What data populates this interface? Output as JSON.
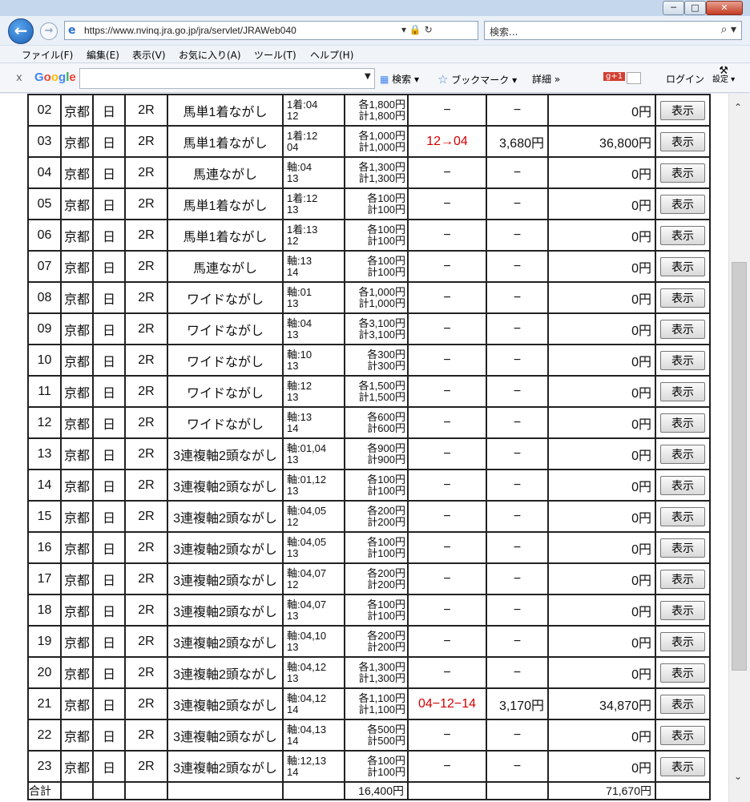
{
  "window": {
    "minimize": "─",
    "maximize": "□",
    "close": "✕"
  },
  "nav": {
    "back_icon": "back-arrow-icon",
    "forward_icon": "forward-arrow-icon",
    "url": "https://www.nvinq.jra.go.jp/jra/servlet/JRAWeb040",
    "url_tools": "▾ 🔒 ↻",
    "search_placeholder": "検索...",
    "search_glyph": "⌕ ▾"
  },
  "menu": [
    "ファイル(F)",
    "編集(E)",
    "表示(V)",
    "お気に入り(A)",
    "ツール(T)",
    "ヘルプ(H)"
  ],
  "googlebar": {
    "close": "x",
    "logo": [
      "G",
      "o",
      "o",
      "g",
      "l",
      "e"
    ],
    "logo_colors": [
      "#4285f4",
      "#ea4335",
      "#fbbc05",
      "#4285f4",
      "#34a853",
      "#ea4335"
    ],
    "search": "検索 ▾",
    "bookmark": "ブックマーク ▾",
    "detail": "詳細 »",
    "gplus": "g+1",
    "login": "ログイン",
    "settings": "設定 ▾"
  },
  "show_label": "表示",
  "rows": [
    {
      "no": "02",
      "place": "京都",
      "day": "日",
      "race": "2R",
      "type": "馬単1着ながし",
      "bet1": "1着:04",
      "bet2": "12",
      "amt1": "各1,800円",
      "amt2": "計1,800円",
      "hit": "−",
      "pay": "−",
      "ret": "0円"
    },
    {
      "no": "03",
      "place": "京都",
      "day": "日",
      "race": "2R",
      "type": "馬単1着ながし",
      "bet1": "1着:12",
      "bet2": "04",
      "amt1": "各1,000円",
      "amt2": "計1,000円",
      "hit": "12→04",
      "pay": "3,680円",
      "ret": "36,800円",
      "is_hit": true
    },
    {
      "no": "04",
      "place": "京都",
      "day": "日",
      "race": "2R",
      "type": "馬連ながし",
      "bet1": "軸:04",
      "bet2": "13",
      "amt1": "各1,300円",
      "amt2": "計1,300円",
      "hit": "−",
      "pay": "−",
      "ret": "0円"
    },
    {
      "no": "05",
      "place": "京都",
      "day": "日",
      "race": "2R",
      "type": "馬単1着ながし",
      "bet1": "1着:12",
      "bet2": "13",
      "amt1": "各100円",
      "amt2": "計100円",
      "hit": "−",
      "pay": "−",
      "ret": "0円"
    },
    {
      "no": "06",
      "place": "京都",
      "day": "日",
      "race": "2R",
      "type": "馬単1着ながし",
      "bet1": "1着:13",
      "bet2": "12",
      "amt1": "各100円",
      "amt2": "計100円",
      "hit": "−",
      "pay": "−",
      "ret": "0円"
    },
    {
      "no": "07",
      "place": "京都",
      "day": "日",
      "race": "2R",
      "type": "馬連ながし",
      "bet1": "軸:13",
      "bet2": "14",
      "amt1": "各100円",
      "amt2": "計100円",
      "hit": "−",
      "pay": "−",
      "ret": "0円"
    },
    {
      "no": "08",
      "place": "京都",
      "day": "日",
      "race": "2R",
      "type": "ワイドながし",
      "bet1": "軸:01",
      "bet2": "13",
      "amt1": "各1,000円",
      "amt2": "計1,000円",
      "hit": "−",
      "pay": "−",
      "ret": "0円"
    },
    {
      "no": "09",
      "place": "京都",
      "day": "日",
      "race": "2R",
      "type": "ワイドながし",
      "bet1": "軸:04",
      "bet2": "13",
      "amt1": "各3,100円",
      "amt2": "計3,100円",
      "hit": "−",
      "pay": "−",
      "ret": "0円"
    },
    {
      "no": "10",
      "place": "京都",
      "day": "日",
      "race": "2R",
      "type": "ワイドながし",
      "bet1": "軸:10",
      "bet2": "13",
      "amt1": "各300円",
      "amt2": "計300円",
      "hit": "−",
      "pay": "−",
      "ret": "0円"
    },
    {
      "no": "11",
      "place": "京都",
      "day": "日",
      "race": "2R",
      "type": "ワイドながし",
      "bet1": "軸:12",
      "bet2": "13",
      "amt1": "各1,500円",
      "amt2": "計1,500円",
      "hit": "−",
      "pay": "−",
      "ret": "0円"
    },
    {
      "no": "12",
      "place": "京都",
      "day": "日",
      "race": "2R",
      "type": "ワイドながし",
      "bet1": "軸:13",
      "bet2": "14",
      "amt1": "各600円",
      "amt2": "計600円",
      "hit": "−",
      "pay": "−",
      "ret": "0円"
    },
    {
      "no": "13",
      "place": "京都",
      "day": "日",
      "race": "2R",
      "type": "3連複軸2頭ながし",
      "bet1": "軸:01,04",
      "bet2": "13",
      "amt1": "各900円",
      "amt2": "計900円",
      "hit": "−",
      "pay": "−",
      "ret": "0円"
    },
    {
      "no": "14",
      "place": "京都",
      "day": "日",
      "race": "2R",
      "type": "3連複軸2頭ながし",
      "bet1": "軸:01,12",
      "bet2": "13",
      "amt1": "各100円",
      "amt2": "計100円",
      "hit": "−",
      "pay": "−",
      "ret": "0円"
    },
    {
      "no": "15",
      "place": "京都",
      "day": "日",
      "race": "2R",
      "type": "3連複軸2頭ながし",
      "bet1": "軸:04,05",
      "bet2": "12",
      "amt1": "各200円",
      "amt2": "計200円",
      "hit": "−",
      "pay": "−",
      "ret": "0円"
    },
    {
      "no": "16",
      "place": "京都",
      "day": "日",
      "race": "2R",
      "type": "3連複軸2頭ながし",
      "bet1": "軸:04,05",
      "bet2": "13",
      "amt1": "各100円",
      "amt2": "計100円",
      "hit": "−",
      "pay": "−",
      "ret": "0円"
    },
    {
      "no": "17",
      "place": "京都",
      "day": "日",
      "race": "2R",
      "type": "3連複軸2頭ながし",
      "bet1": "軸:04,07",
      "bet2": "12",
      "amt1": "各200円",
      "amt2": "計200円",
      "hit": "−",
      "pay": "−",
      "ret": "0円"
    },
    {
      "no": "18",
      "place": "京都",
      "day": "日",
      "race": "2R",
      "type": "3連複軸2頭ながし",
      "bet1": "軸:04,07",
      "bet2": "13",
      "amt1": "各100円",
      "amt2": "計100円",
      "hit": "−",
      "pay": "−",
      "ret": "0円"
    },
    {
      "no": "19",
      "place": "京都",
      "day": "日",
      "race": "2R",
      "type": "3連複軸2頭ながし",
      "bet1": "軸:04,10",
      "bet2": "13",
      "amt1": "各200円",
      "amt2": "計200円",
      "hit": "−",
      "pay": "−",
      "ret": "0円"
    },
    {
      "no": "20",
      "place": "京都",
      "day": "日",
      "race": "2R",
      "type": "3連複軸2頭ながし",
      "bet1": "軸:04,12",
      "bet2": "13",
      "amt1": "各1,300円",
      "amt2": "計1,300円",
      "hit": "−",
      "pay": "−",
      "ret": "0円"
    },
    {
      "no": "21",
      "place": "京都",
      "day": "日",
      "race": "2R",
      "type": "3連複軸2頭ながし",
      "bet1": "軸:04,12",
      "bet2": "14",
      "amt1": "各1,100円",
      "amt2": "計1,100円",
      "hit": "04−12−14",
      "pay": "3,170円",
      "ret": "34,870円",
      "is_hit": true
    },
    {
      "no": "22",
      "place": "京都",
      "day": "日",
      "race": "2R",
      "type": "3連複軸2頭ながし",
      "bet1": "軸:04,13",
      "bet2": "14",
      "amt1": "各500円",
      "amt2": "計500円",
      "hit": "−",
      "pay": "−",
      "ret": "0円"
    },
    {
      "no": "23",
      "place": "京都",
      "day": "日",
      "race": "2R",
      "type": "3連複軸2頭ながし",
      "bet1": "軸:12,13",
      "bet2": "14",
      "amt1": "各100円",
      "amt2": "計100円",
      "hit": "−",
      "pay": "−",
      "ret": "0円"
    }
  ],
  "total": {
    "label": "合計",
    "amount": "16,400円",
    "ret": "71,670円"
  },
  "colors": {
    "hit": "#d40000",
    "chrome": "#eaf0f8"
  }
}
